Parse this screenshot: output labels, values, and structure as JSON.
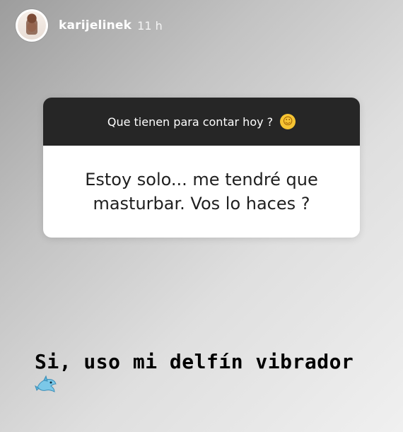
{
  "header": {
    "username": "karijelinek",
    "time": "11 h"
  },
  "question_card": {
    "prompt": "Que tienen para contar hoy ?",
    "answer": "Estoy solo... me tendré que masturbar. Vos lo haces ?"
  },
  "reply": {
    "text": "Si, uso mi delfín vibrador"
  },
  "icons": {
    "avatar": "profile-avatar",
    "emoji": "hugging-face-icon",
    "reply_emoji": "dolphin-icon"
  },
  "colors": {
    "question_header": "#262626",
    "question_body": "#ffffff",
    "text_primary": "#1f1f1f",
    "reply_text": "#000000"
  }
}
